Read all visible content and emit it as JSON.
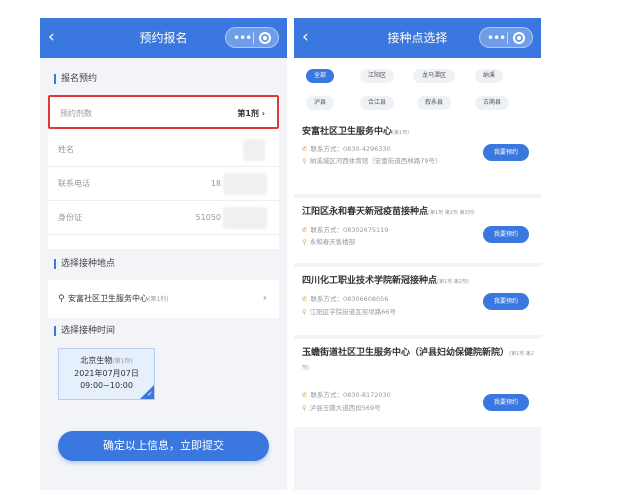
{
  "left": {
    "nav": {
      "back": "‹",
      "title": "预约报名"
    },
    "section_signup": "报名预约",
    "rows": [
      {
        "label": "预约剂数",
        "value": "第1剂 ›"
      },
      {
        "label": "姓名",
        "value": ""
      },
      {
        "label": "联系电话",
        "value": "18"
      },
      {
        "label": "身份证",
        "value": "51050"
      }
    ],
    "section_site": "选择接种地点",
    "site": {
      "name": "安富社区卫生服务中心",
      "dose": "(第1剂)",
      "arrow": "›"
    },
    "section_time": "选择接种时间",
    "slot": {
      "vendor": "北京生物",
      "dose": "(第1剂)",
      "date": "2021年07月07日",
      "time": "09:00~10:00"
    },
    "submit": "确定以上信息，立即提交"
  },
  "right": {
    "nav": {
      "back": "‹",
      "title": "接种点选择"
    },
    "chips": [
      "全部",
      "江阳区",
      "龙马潭区",
      "纳溪",
      "泸县",
      "合江县",
      "叙永县",
      "古蔺县"
    ],
    "sites": [
      {
        "name": "安富社区卫生服务中心",
        "dose": "(第1剂)",
        "phone": "联系方式：0830-4296330",
        "address": "纳溪城区河西体育馆（安富街道西林路79号）",
        "button": "我要预约"
      },
      {
        "name": "江阳区永和春天新冠疫苗接种点",
        "dose": "(第1剂 第2剂 第3剂)",
        "phone": "联系方式：08302675119",
        "address": "永和春天售楼部",
        "button": "我要预约"
      },
      {
        "name": "四川化工职业技术学院新冠接种点",
        "dose": "(第1剂 第2剂)",
        "phone": "联系方式：08306608056",
        "address": "江阳区学院街道瓦窑坝路66号",
        "button": "我要预约"
      },
      {
        "name": "玉蟾街道社区卫生服务中心（泸县妇幼保健院新院）",
        "dose": "(第1剂 第2剂)",
        "phone": "联系方式：0830-8172030",
        "address": "泸县玉蟾大道西段569号",
        "button": "我要预约"
      }
    ]
  },
  "icons": {
    "phone": "phone-icon",
    "location": "location-pin-icon",
    "menu": "more-dots-icon",
    "close": "target-close-icon"
  },
  "colors": {
    "primary": "#3a78e0",
    "highlight": "#e0383b",
    "slot_bg": "#e6effc"
  }
}
